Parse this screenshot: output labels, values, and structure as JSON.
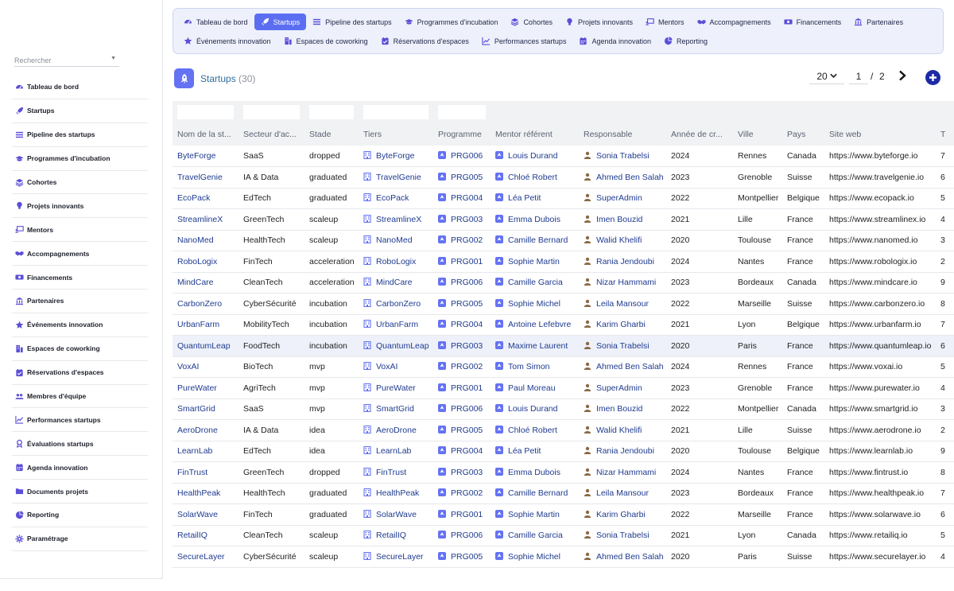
{
  "search": {
    "placeholder": "Rechercher"
  },
  "sidebar": {
    "items": [
      {
        "label": "Tableau de bord",
        "icon": "dashboard-icon"
      },
      {
        "label": "Startups",
        "icon": "rocket-icon"
      },
      {
        "label": "Pipeline des startups",
        "icon": "list-icon"
      },
      {
        "label": "Programmes d'incubation",
        "icon": "graduation-cap-icon"
      },
      {
        "label": "Cohortes",
        "icon": "layers-icon"
      },
      {
        "label": "Projets innovants",
        "icon": "lightbulb-icon"
      },
      {
        "label": "Mentors",
        "icon": "chalkboard-icon"
      },
      {
        "label": "Accompagnements",
        "icon": "handshake-icon"
      },
      {
        "label": "Financements",
        "icon": "money-icon"
      },
      {
        "label": "Partenaires",
        "icon": "institution-icon"
      },
      {
        "label": "Événements innovation",
        "icon": "star-icon"
      },
      {
        "label": "Espaces de coworking",
        "icon": "building-icon"
      },
      {
        "label": "Réservations d'espaces",
        "icon": "calendar-check-icon"
      },
      {
        "label": "Membres d'équipe",
        "icon": "users-icon"
      },
      {
        "label": "Performances startups",
        "icon": "line-chart-icon"
      },
      {
        "label": "Évaluations startups",
        "icon": "award-icon"
      },
      {
        "label": "Agenda innovation",
        "icon": "calendar-icon"
      },
      {
        "label": "Documents projets",
        "icon": "folder-icon"
      },
      {
        "label": "Reporting",
        "icon": "pie-chart-icon"
      },
      {
        "label": "Paramétrage",
        "icon": "gear-icon"
      }
    ]
  },
  "topnav": {
    "row1": [
      {
        "label": "Tableau de bord",
        "icon": "dashboard-icon"
      },
      {
        "label": "Startups",
        "icon": "rocket-icon",
        "active": true
      },
      {
        "label": "Pipeline des startups",
        "icon": "list-icon"
      },
      {
        "label": "Programmes d'incubation",
        "icon": "graduation-cap-icon"
      },
      {
        "label": "Cohortes",
        "icon": "layers-icon"
      },
      {
        "label": "Projets innovants",
        "icon": "lightbulb-icon"
      },
      {
        "label": "Mentors",
        "icon": "chalkboard-icon"
      },
      {
        "label": "Accompagnements",
        "icon": "handshake-icon"
      },
      {
        "label": "Financements",
        "icon": "money-icon"
      },
      {
        "label": "Partenaires",
        "icon": "institution-icon"
      }
    ],
    "row2": [
      {
        "label": "Événements innovation",
        "icon": "star-icon"
      },
      {
        "label": "Espaces de coworking",
        "icon": "building-icon"
      },
      {
        "label": "Réservations d'espaces",
        "icon": "calendar-check-icon"
      },
      {
        "label": "Performances startups",
        "icon": "line-chart-icon"
      },
      {
        "label": "Agenda innovation",
        "icon": "calendar-icon"
      },
      {
        "label": "Reporting",
        "icon": "pie-chart-icon"
      }
    ]
  },
  "header": {
    "title": "Startups",
    "count": "(30)"
  },
  "pagination": {
    "page_size": "20",
    "current": "1",
    "separator": "/",
    "total": "2"
  },
  "colors": {
    "accent": "#5b6ef2",
    "primary_dark": "#1d2aa6",
    "link": "#1f3b8f",
    "icon_purple": "#6472f3",
    "user_brown": "#8a6a45"
  },
  "table": {
    "columns": [
      "Nom de la st...",
      "Secteur d'ac...",
      "Stade",
      "Tiers",
      "Programme",
      "Mentor référent",
      "Responsable",
      "Année de cr...",
      "Ville",
      "Pays",
      "Site web",
      "T"
    ],
    "rows": [
      [
        "ByteForge",
        "SaaS",
        "dropped",
        "ByteForge",
        "PRG006",
        "Louis Durand",
        "Sonia Trabelsi",
        "2024",
        "Rennes",
        "Canada",
        "https://www.byteforge.io",
        "7"
      ],
      [
        "TravelGenie",
        "IA & Data",
        "graduated",
        "TravelGenie",
        "PRG005",
        "Chloé Robert",
        "Ahmed Ben Salah",
        "2023",
        "Grenoble",
        "Suisse",
        "https://www.travelgenie.io",
        "6"
      ],
      [
        "EcoPack",
        "EdTech",
        "graduated",
        "EcoPack",
        "PRG004",
        "Léa Petit",
        "SuperAdmin",
        "2022",
        "Montpellier",
        "Belgique",
        "https://www.ecopack.io",
        "5"
      ],
      [
        "StreamlineX",
        "GreenTech",
        "scaleup",
        "StreamlineX",
        "PRG003",
        "Emma Dubois",
        "Imen Bouzid",
        "2021",
        "Lille",
        "France",
        "https://www.streamlinex.io",
        "4"
      ],
      [
        "NanoMed",
        "HealthTech",
        "scaleup",
        "NanoMed",
        "PRG002",
        "Camille Bernard",
        "Walid Khelifi",
        "2020",
        "Toulouse",
        "France",
        "https://www.nanomed.io",
        "3"
      ],
      [
        "RoboLogix",
        "FinTech",
        "acceleration",
        "RoboLogix",
        "PRG001",
        "Sophie Martin",
        "Rania Jendoubi",
        "2024",
        "Nantes",
        "France",
        "https://www.robologix.io",
        "2"
      ],
      [
        "MindCare",
        "CleanTech",
        "acceleration",
        "MindCare",
        "PRG006",
        "Camille Garcia",
        "Nizar Hammami",
        "2023",
        "Bordeaux",
        "Canada",
        "https://www.mindcare.io",
        "9"
      ],
      [
        "CarbonZero",
        "CyberSécurité",
        "incubation",
        "CarbonZero",
        "PRG005",
        "Sophie Michel",
        "Leila Mansour",
        "2022",
        "Marseille",
        "Suisse",
        "https://www.carbonzero.io",
        "8"
      ],
      [
        "UrbanFarm",
        "MobilityTech",
        "incubation",
        "UrbanFarm",
        "PRG004",
        "Antoine Lefebvre",
        "Karim Gharbi",
        "2021",
        "Lyon",
        "Belgique",
        "https://www.urbanfarm.io",
        "7"
      ],
      [
        "QuantumLeap",
        "FoodTech",
        "incubation",
        "QuantumLeap",
        "PRG003",
        "Maxime Laurent",
        "Sonia Trabelsi",
        "2020",
        "Paris",
        "France",
        "https://www.quantumleap.io",
        "6"
      ],
      [
        "VoxAI",
        "BioTech",
        "mvp",
        "VoxAI",
        "PRG002",
        "Tom Simon",
        "Ahmed Ben Salah",
        "2024",
        "Rennes",
        "France",
        "https://www.voxai.io",
        "5"
      ],
      [
        "PureWater",
        "AgriTech",
        "mvp",
        "PureWater",
        "PRG001",
        "Paul Moreau",
        "SuperAdmin",
        "2023",
        "Grenoble",
        "France",
        "https://www.purewater.io",
        "4"
      ],
      [
        "SmartGrid",
        "SaaS",
        "mvp",
        "SmartGrid",
        "PRG006",
        "Louis Durand",
        "Imen Bouzid",
        "2022",
        "Montpellier",
        "Canada",
        "https://www.smartgrid.io",
        "3"
      ],
      [
        "AeroDrone",
        "IA & Data",
        "idea",
        "AeroDrone",
        "PRG005",
        "Chloé Robert",
        "Walid Khelifi",
        "2021",
        "Lille",
        "Suisse",
        "https://www.aerodrone.io",
        "2"
      ],
      [
        "LearnLab",
        "EdTech",
        "idea",
        "LearnLab",
        "PRG004",
        "Léa Petit",
        "Rania Jendoubi",
        "2020",
        "Toulouse",
        "Belgique",
        "https://www.learnlab.io",
        "9"
      ],
      [
        "FinTrust",
        "GreenTech",
        "dropped",
        "FinTrust",
        "PRG003",
        "Emma Dubois",
        "Nizar Hammami",
        "2024",
        "Nantes",
        "France",
        "https://www.fintrust.io",
        "8"
      ],
      [
        "HealthPeak",
        "HealthTech",
        "graduated",
        "HealthPeak",
        "PRG002",
        "Camille Bernard",
        "Leila Mansour",
        "2023",
        "Bordeaux",
        "France",
        "https://www.healthpeak.io",
        "7"
      ],
      [
        "SolarWave",
        "FinTech",
        "graduated",
        "SolarWave",
        "PRG001",
        "Sophie Martin",
        "Karim Gharbi",
        "2022",
        "Marseille",
        "France",
        "https://www.solarwave.io",
        "6"
      ],
      [
        "RetailIQ",
        "CleanTech",
        "scaleup",
        "RetailIQ",
        "PRG006",
        "Camille Garcia",
        "Sonia Trabelsi",
        "2021",
        "Lyon",
        "Canada",
        "https://www.retailiq.io",
        "5"
      ],
      [
        "SecureLayer",
        "CyberSécurité",
        "scaleup",
        "SecureLayer",
        "PRG005",
        "Sophie Michel",
        "Ahmed Ben Salah",
        "2020",
        "Paris",
        "Suisse",
        "https://www.securelayer.io",
        "4"
      ]
    ],
    "highlighted_row": 9
  }
}
